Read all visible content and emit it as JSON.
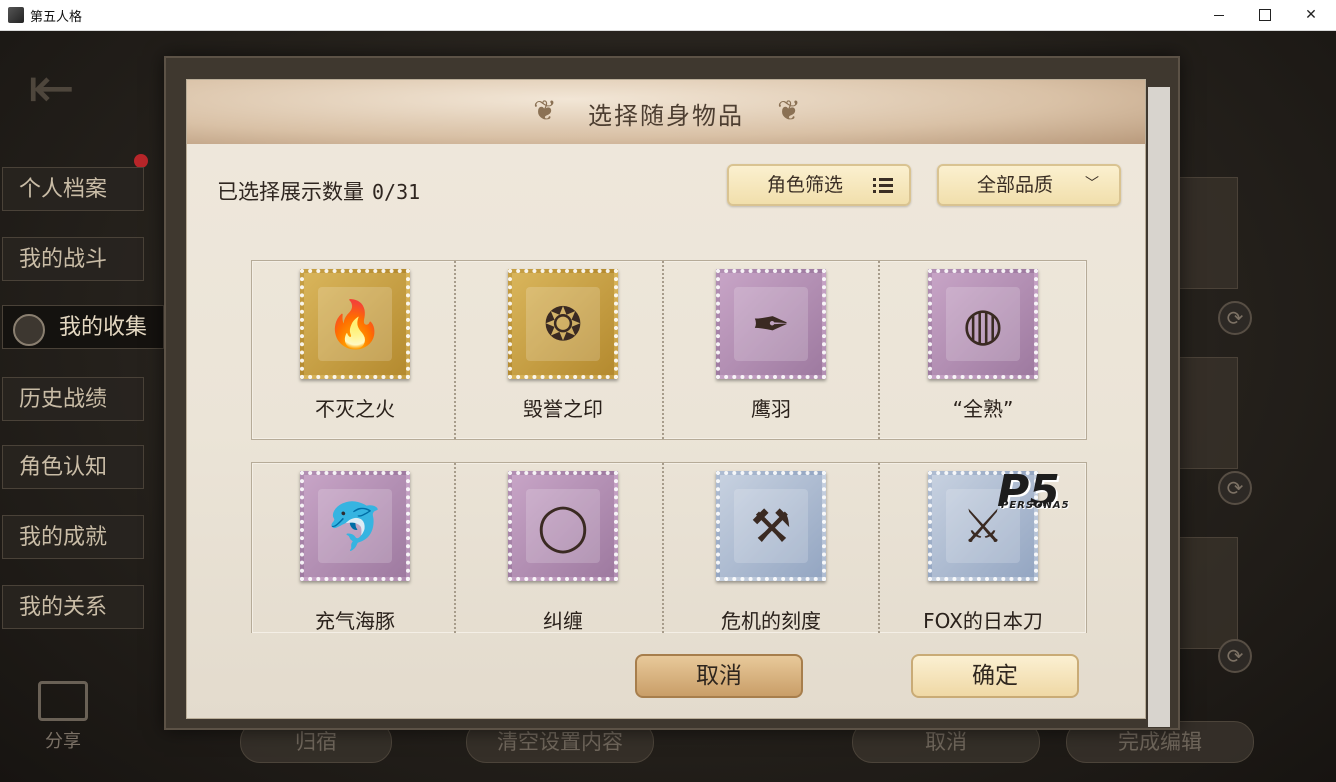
{
  "window": {
    "title": "第五人格"
  },
  "sidebar": {
    "items": [
      {
        "label": "个人档案"
      },
      {
        "label": "我的战斗"
      },
      {
        "label": "我的收集"
      },
      {
        "label": "历史战绩"
      },
      {
        "label": "角色认知"
      },
      {
        "label": "我的成就"
      },
      {
        "label": "我的关系"
      }
    ],
    "share_label": "分享"
  },
  "bottom_bar": {
    "home_label": "归宿",
    "clear_label": "清空设置内容",
    "cancel_label": "取消",
    "done_label": "完成编辑"
  },
  "dialog": {
    "title": "选择随身物品",
    "count_label": "已选择展示数量",
    "count_value": "0/31",
    "filter_label": "角色筛选",
    "quality_label": "全部品质",
    "items": [
      {
        "label": "不灭之火",
        "rarity": "gold"
      },
      {
        "label": "毁誉之印",
        "rarity": "gold"
      },
      {
        "label": "鹰羽",
        "rarity": "purple"
      },
      {
        "label": "“全熟”",
        "rarity": "purple"
      },
      {
        "label": "充气海豚",
        "rarity": "purple"
      },
      {
        "label": "纠缠",
        "rarity": "purple"
      },
      {
        "label": "危机的刻度",
        "rarity": "blue"
      },
      {
        "label": "FOX的日本刀",
        "rarity": "blue"
      }
    ],
    "cancel_label": "取消",
    "confirm_label": "确定"
  },
  "colors": {
    "gold": "#d9b55b",
    "purple": "#c7a4c6",
    "blue": "#c7d1e0"
  }
}
